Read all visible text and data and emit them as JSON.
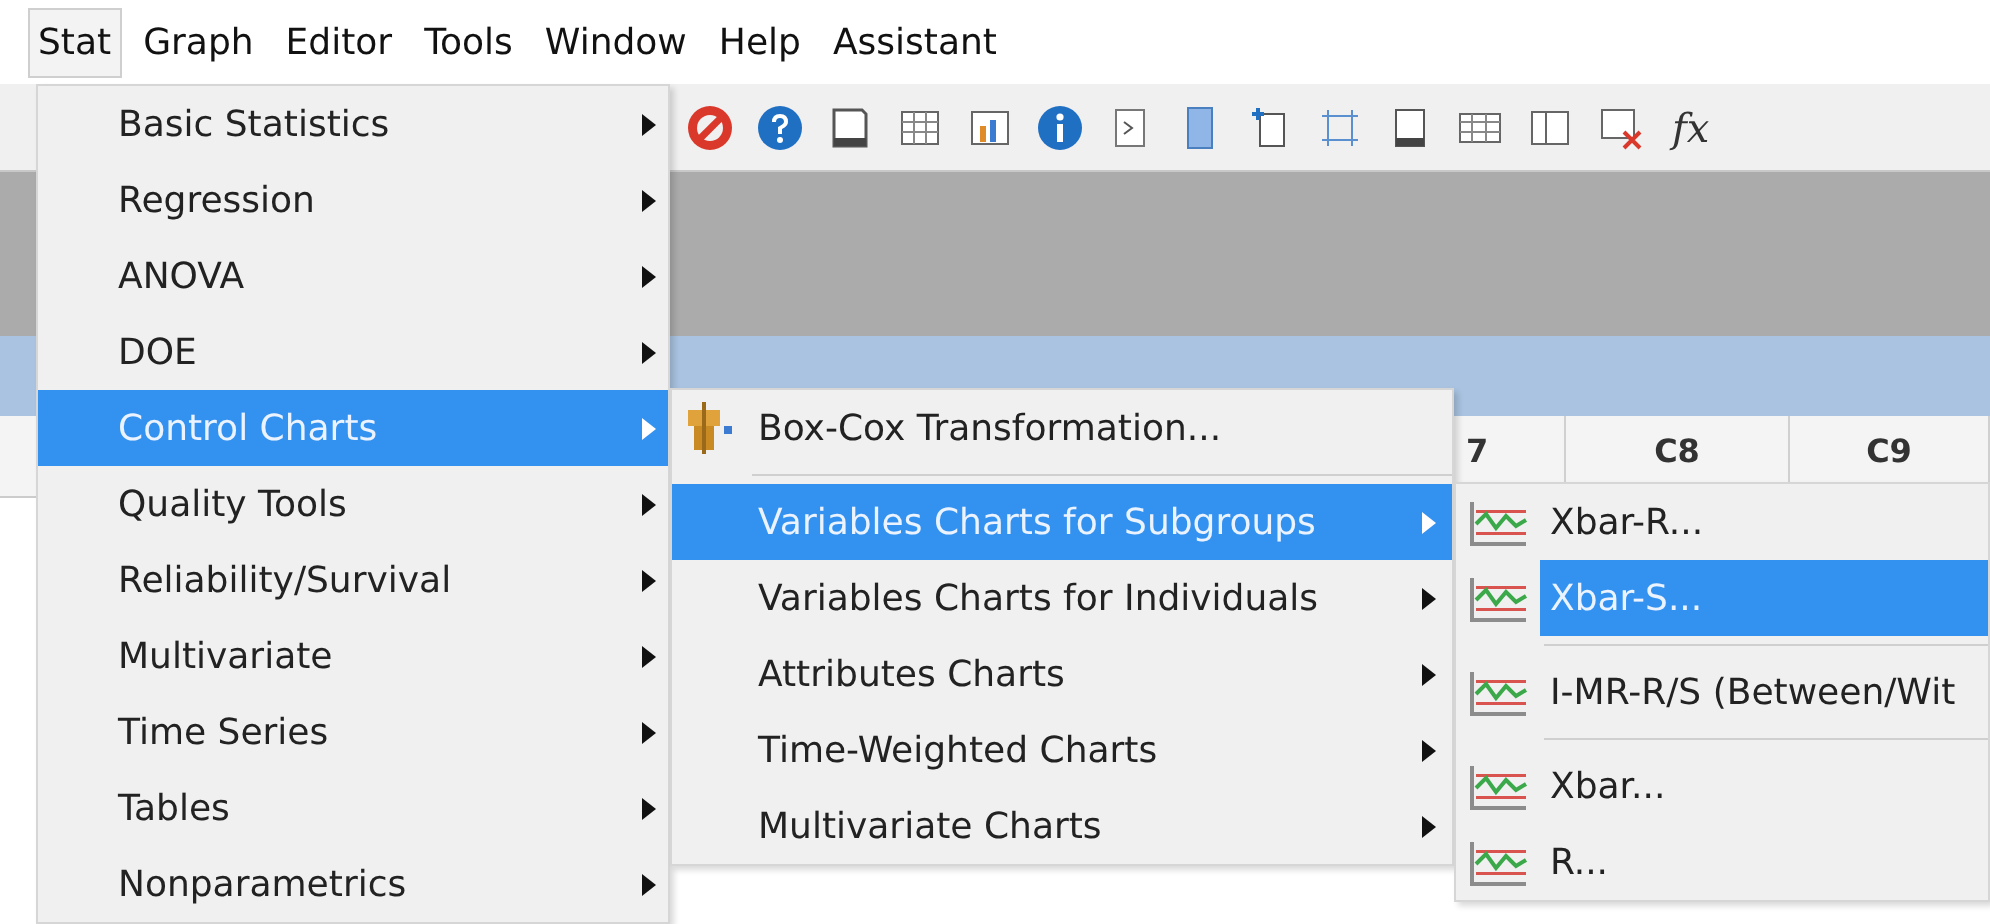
{
  "menu_bar": {
    "items": [
      {
        "label": "Stat",
        "selected": true
      },
      {
        "label": "Graph",
        "selected": false
      },
      {
        "label": "Editor",
        "selected": false
      },
      {
        "label": "Tools",
        "selected": false
      },
      {
        "label": "Window",
        "selected": false
      },
      {
        "label": "Help",
        "selected": false
      },
      {
        "label": "Assistant",
        "selected": false
      }
    ]
  },
  "toolbar": {
    "function_button": "fx"
  },
  "worksheet": {
    "column_headers": [
      "7",
      "C8",
      "C9"
    ]
  },
  "stat_menu": {
    "items": [
      {
        "label": "Basic Statistics",
        "selected": false
      },
      {
        "label": "Regression",
        "selected": false
      },
      {
        "label": "ANOVA",
        "selected": false
      },
      {
        "label": "DOE",
        "selected": false
      },
      {
        "label": "Control Charts",
        "selected": true
      },
      {
        "label": "Quality Tools",
        "selected": false
      },
      {
        "label": "Reliability/Survival",
        "selected": false
      },
      {
        "label": "Multivariate",
        "selected": false
      },
      {
        "label": "Time Series",
        "selected": false
      },
      {
        "label": "Tables",
        "selected": false
      },
      {
        "label": "Nonparametrics",
        "selected": false
      }
    ]
  },
  "control_charts_menu": {
    "items": [
      {
        "kind": "command",
        "label": "Box-Cox Transformation...",
        "selected": false
      },
      {
        "kind": "separator"
      },
      {
        "kind": "submenu",
        "label": "Variables Charts for Subgroups",
        "selected": true
      },
      {
        "kind": "submenu",
        "label": "Variables Charts for Individuals",
        "selected": false
      },
      {
        "kind": "submenu",
        "label": "Attributes Charts",
        "selected": false
      },
      {
        "kind": "submenu",
        "label": "Time-Weighted Charts",
        "selected": false
      },
      {
        "kind": "submenu",
        "label": "Multivariate Charts",
        "selected": false
      }
    ]
  },
  "subgroups_menu": {
    "items": [
      {
        "kind": "command",
        "label": "Xbar-R...",
        "selected": false
      },
      {
        "kind": "command",
        "label": "Xbar-S...",
        "selected": true
      },
      {
        "kind": "separator"
      },
      {
        "kind": "command",
        "label": "I-MR-R/S (Between/Wit",
        "selected": false
      },
      {
        "kind": "separator"
      },
      {
        "kind": "command",
        "label": "Xbar...",
        "selected": false
      },
      {
        "kind": "command",
        "label": "R...",
        "selected": false
      }
    ]
  }
}
